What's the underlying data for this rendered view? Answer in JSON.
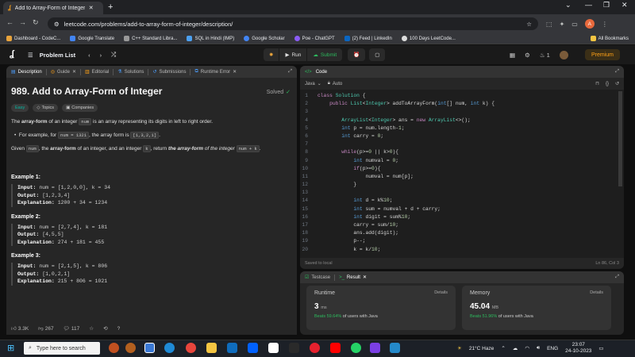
{
  "browser": {
    "tab_title": "Add to Array-Form of Integer - L",
    "url": "leetcode.com/problems/add-to-array-form-of-integer/description/",
    "profile_initial": "A",
    "bookmarks": [
      "Dashboard - CodeC...",
      "Google Translate",
      "C++ Standard Libra...",
      "SQL in Hindi (IMP)",
      "Google Scholar",
      "Poe - ChatGPT",
      "(2) Feed | LinkedIn",
      "100 Days LeetCode..."
    ],
    "all_bookmarks": "All Bookmarks"
  },
  "lc": {
    "problem_list": "Problem List",
    "run": "Run",
    "submit": "Submit",
    "streak": "1",
    "premium": "Premium"
  },
  "left": {
    "tabs": [
      "Description",
      "Guide",
      "Editorial",
      "Solutions",
      "Submissions",
      "Runtime Error"
    ],
    "title": "989. Add to Array-Form of Integer",
    "solved": "Solved",
    "tags": [
      "Easy",
      "Topics",
      "Companies"
    ],
    "p1": [
      "The ",
      "array-form",
      " of an integer ",
      "num",
      " is an array representing its digits in left to right order."
    ],
    "p2": [
      "For example, for ",
      "num = 1321",
      ", the array form is ",
      "[1,3,2,1]",
      "."
    ],
    "p3": [
      "Given ",
      "num",
      ", the ",
      "array-form",
      " of an integer, and an integer ",
      "k",
      ", return ",
      "the array-form",
      " of the integer ",
      "num + k",
      "."
    ],
    "examples": [
      {
        "h": "Example 1:",
        "input": "num = [1,2,0,0], k = 34",
        "output": "[1,2,3,4]",
        "exp": "1200 + 34 = 1234"
      },
      {
        "h": "Example 2:",
        "input": "num = [2,7,4], k = 181",
        "output": "[4,5,5]",
        "exp": "274 + 181 = 455"
      },
      {
        "h": "Example 3:",
        "input": "num = [2,1,5], k = 806",
        "output": "[1,0,2,1]",
        "exp": "215 + 806 = 1021"
      }
    ],
    "labels": {
      "input": "Input:",
      "output": "Output:",
      "exp": "Explanation:"
    },
    "likes": "3.3K",
    "dislikes": "267",
    "comments": "117"
  },
  "code": {
    "header": "Code",
    "lang": "Java",
    "auto": "Auto",
    "lines": [
      "class Solution {",
      "    public List<Integer> addToArrayForm(int[] num, int k) {",
      "",
      "        ArrayList<Integer> ans = new ArrayList<>();",
      "        int p = num.length-1;",
      "        int carry = 0;",
      "",
      "        while(p>=0 || k>0){",
      "            int numval = 0;",
      "            if(p>=0){",
      "                numval = num[p];",
      "            }",
      "",
      "            int d = k%10;",
      "            int sum = numval + d + carry;",
      "            int digit = sum%10;",
      "            carry = sum/10;",
      "            ans.add(digit);",
      "            p--;",
      "            k = k/10;"
    ],
    "saved": "Saved to local",
    "pos": "Ln 86, Col 3"
  },
  "result": {
    "tabs": [
      "Testcase",
      "Result"
    ],
    "runtime": {
      "label": "Runtime",
      "details": "Details",
      "value": "3",
      "unit": "ms",
      "beats": "Beats 59.64%",
      "rest": " of users with Java"
    },
    "memory": {
      "label": "Memory",
      "details": "Details",
      "value": "45.04",
      "unit": "MB",
      "beats": "Beats 51.96%",
      "rest": " of users with Java"
    }
  },
  "taskbar": {
    "search": "Type here to search",
    "weather": "21°C  Haze",
    "lang": "ENG",
    "time": "23:07",
    "date": "24-10-2023"
  }
}
